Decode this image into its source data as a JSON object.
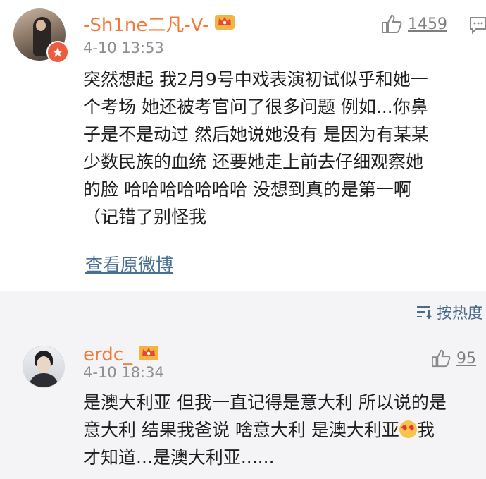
{
  "comment": {
    "username": "-Sh1ne二凡-V-",
    "time": "4-10 13:53",
    "likes": "1459",
    "lines": [
      "突然想起 我2月9号中戏表演初试似乎和她一",
      "个考场 她还被考官问了很多问题 例如...你鼻",
      "子是不是动过 然后她说她没有 是因为有某某",
      "少数民族的血统 还要她走上前去仔细观察她",
      "的脸 哈哈哈哈哈哈哈 没想到真的是第一啊",
      "（记错了别怪我"
    ],
    "view_original": "查看原微博"
  },
  "sort": {
    "label": "按热度"
  },
  "reply": {
    "username": "erdc_",
    "time": "4-10 18:34",
    "likes": "95",
    "line1": "是澳大利亚 但我一直记得是意大利 所以说的是",
    "line2_a": "意大利 结果我爸说 啥意大利 是澳大利亚",
    "line2_b": "我",
    "line3": "才知道...是澳大利亚......"
  },
  "colors": {
    "username": "#f07a3b",
    "link": "#4a6f95",
    "meta": "#8f8f8f",
    "background_gray": "#f4f4f6"
  },
  "icons": [
    "crown-icon",
    "verified-icon",
    "thumbs-up-icon",
    "comment-icon",
    "sort-icon",
    "heart-eyes-emoji"
  ]
}
